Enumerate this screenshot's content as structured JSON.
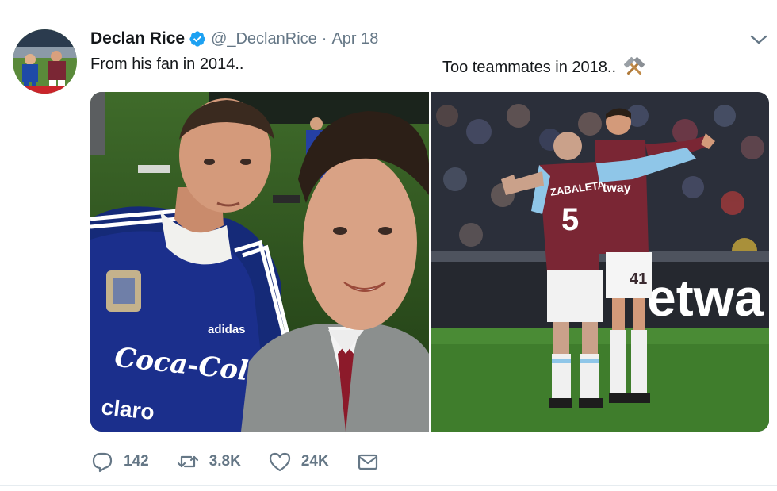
{
  "tweet": {
    "author_name": "Declan Rice",
    "handle": "@_DeclanRice",
    "separator": "·",
    "date": "Apr 18",
    "text_left": "From his fan in 2014..",
    "text_right": "Too teammates in 2018..",
    "icons": {
      "verified": "verified-badge-icon",
      "menu": "chevron-down-icon",
      "emoji": "hammers-emoji-icon"
    },
    "media": {
      "left_photo_text": {
        "jersey_brand": "adidas",
        "sponsor": "Coca-Cola",
        "sponsor_2": "claro"
      },
      "right_photo_text": {
        "player_name": "ZABALETA",
        "player_number": "5",
        "teammate_number": "41",
        "shirt_sponsor": "tway",
        "board_text": "etwa"
      }
    },
    "actions": {
      "replies": "142",
      "retweets": "3.8K",
      "likes": "24K"
    },
    "colors": {
      "accent": "#1da1f2",
      "muted": "#657786",
      "claret": "#7a2634",
      "sky_blue": "#8fc6e8"
    }
  }
}
